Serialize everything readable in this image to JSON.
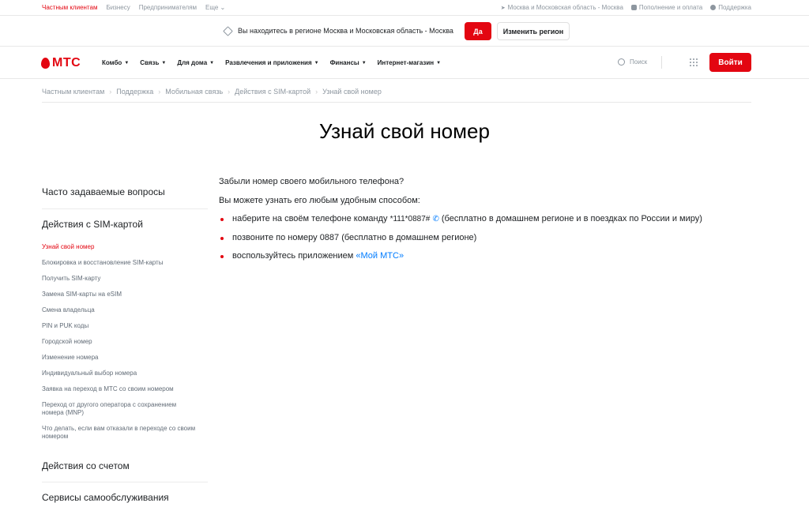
{
  "topbar": {
    "left": [
      "Частным клиентам",
      "Бизнесу",
      "Предпринимателям",
      "Еще"
    ],
    "region": "Москва и Московская область - Москва",
    "pay": "Пополнение и оплата",
    "support": "Поддержка"
  },
  "regbar": {
    "text": "Вы находитесь в регионе Москва и Московская область - Москва",
    "yes": "Да",
    "change": "Изменить регион"
  },
  "header": {
    "logo": "МТС",
    "nav": [
      "Комбо",
      "Связь",
      "Для дома",
      "Развлечения и приложения",
      "Финансы",
      "Интернет-магазин"
    ],
    "search": "Поиск",
    "login": "Войти"
  },
  "breadcrumbs": [
    "Частным клиентам",
    "Поддержка",
    "Мобильная связь",
    "Действия с SIM-картой",
    "Узнай свой номер"
  ],
  "page": {
    "title": "Узнай свой номер"
  },
  "sidebar": {
    "faq": "Часто задаваемые вопросы",
    "sim_section": "Действия с SIM-картой",
    "items": [
      "Узнай свой номер",
      "Блокировка и восстановление SIM-карты",
      "Получить SIM-карту",
      "Замена SIM-карты на eSIM",
      "Смена владельца",
      "PIN и PUK коды",
      "Городской номер",
      "Изменение номера",
      "Индивидуальный выбор номера",
      "Заявка на переход в МТС со своим номером",
      "Переход от другого оператора с сохранением номера (MNP)",
      "Что делать, если вам отказали в переходе со своим номером"
    ],
    "account": "Действия со счетом",
    "self": "Сервисы самообслуживания"
  },
  "content": {
    "p1": "Забыли номер своего мобильного телефона?",
    "p2": "Вы можете узнать его любым удобным способом:",
    "b1a": "наберите на своём телефоне команду ",
    "b1code": "*111*0887#",
    "b1b": " (бесплатно в домашнем регионе и в поездках по России и миру)",
    "b2": "позвоните по номеру 0887 (бесплатно в домашнем регионе)",
    "b3a": "воспользуйтесь приложением ",
    "b3link": "«Мой МТС»"
  },
  "colors": {
    "brand": "#e30611",
    "link": "#007cff"
  }
}
